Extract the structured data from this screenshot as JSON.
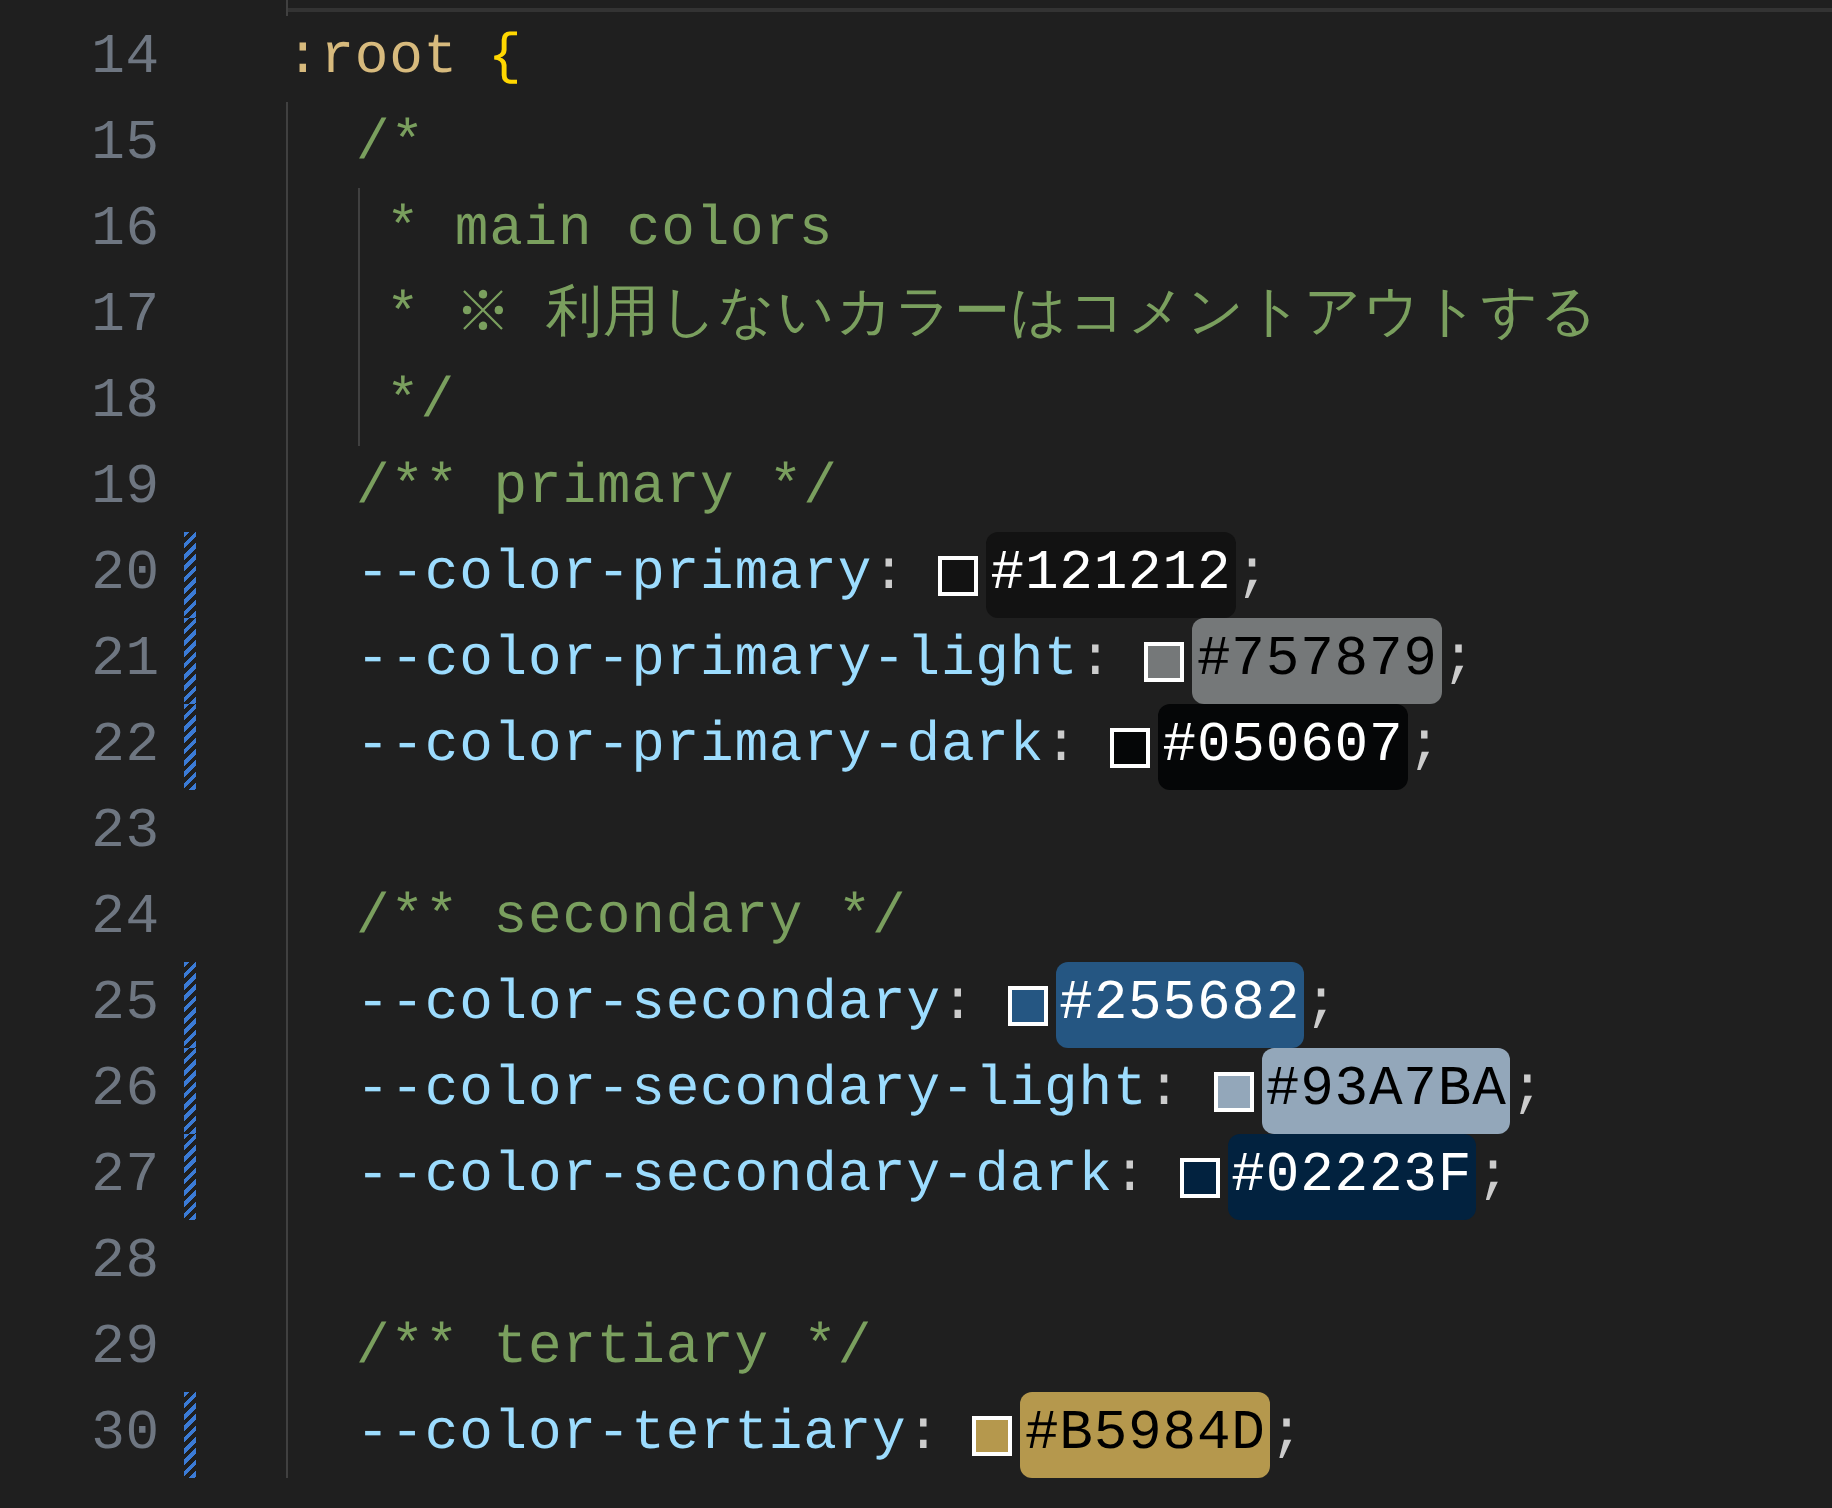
{
  "editor": {
    "lines": [
      {
        "number": "14",
        "kind": "selector",
        "modified": false,
        "selector": ":root",
        "brace": "{"
      },
      {
        "number": "15",
        "kind": "comment",
        "modified": false,
        "text": "/*"
      },
      {
        "number": "16",
        "kind": "comment_body",
        "modified": false,
        "text": "* main colors"
      },
      {
        "number": "17",
        "kind": "comment_body",
        "modified": false,
        "text": "* ※ 利用しないカラーはコメントアウトする"
      },
      {
        "number": "18",
        "kind": "comment_body",
        "modified": false,
        "text": "*/"
      },
      {
        "number": "19",
        "kind": "comment",
        "modified": false,
        "text": "/** primary */"
      },
      {
        "number": "20",
        "kind": "declaration",
        "modified": true,
        "property": "--color-primary",
        "colon": ":",
        "value": "#121212",
        "color": "#121212",
        "semicolon": ";"
      },
      {
        "number": "21",
        "kind": "declaration",
        "modified": true,
        "property": "--color-primary-light",
        "colon": ":",
        "value": "#757879",
        "color": "#757879",
        "semicolon": ";"
      },
      {
        "number": "22",
        "kind": "declaration",
        "modified": true,
        "property": "--color-primary-dark",
        "colon": ":",
        "value": "#050607",
        "color": "#050607",
        "semicolon": ";"
      },
      {
        "number": "23",
        "kind": "blank",
        "modified": false
      },
      {
        "number": "24",
        "kind": "comment",
        "modified": false,
        "text": "/** secondary */"
      },
      {
        "number": "25",
        "kind": "declaration",
        "modified": true,
        "property": "--color-secondary",
        "colon": ":",
        "value": "#255682",
        "color": "#255682",
        "semicolon": ";"
      },
      {
        "number": "26",
        "kind": "declaration",
        "modified": true,
        "property": "--color-secondary-light",
        "colon": ":",
        "value": "#93A7BA",
        "color": "#93a7ba",
        "semicolon": ";"
      },
      {
        "number": "27",
        "kind": "declaration",
        "modified": true,
        "property": "--color-secondary-dark",
        "colon": ":",
        "value": "#02223F",
        "color": "#02223f",
        "semicolon": ";"
      },
      {
        "number": "28",
        "kind": "blank",
        "modified": false
      },
      {
        "number": "29",
        "kind": "comment",
        "modified": false,
        "text": "/** tertiary */"
      },
      {
        "number": "30",
        "kind": "declaration",
        "modified": true,
        "property": "--color-tertiary",
        "colon": ":",
        "value": "#B5984D",
        "color": "#b5984d",
        "semicolon": ";"
      }
    ]
  }
}
